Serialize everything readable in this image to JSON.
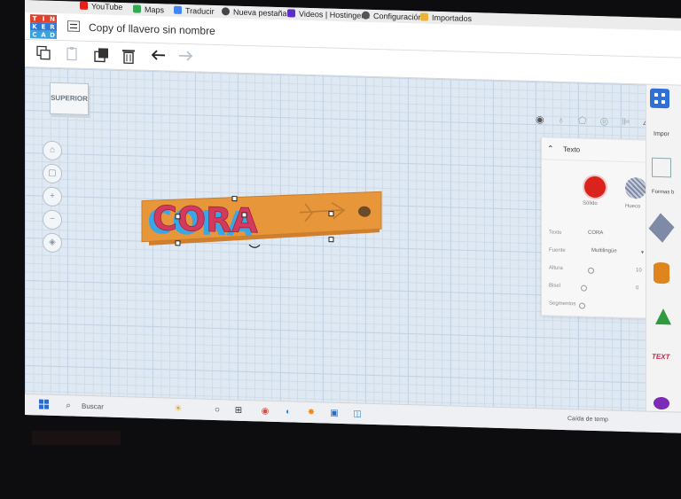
{
  "bookmarks": [
    {
      "label": "YouTube",
      "color": "#e62117"
    },
    {
      "label": "Maps",
      "color": "#34a853"
    },
    {
      "label": "Traducir",
      "color": "#4285f4"
    },
    {
      "label": "Nueva pestaña",
      "color": "#444444"
    },
    {
      "label": "Videos | Hostinger...",
      "color": "#5b2ec7"
    },
    {
      "label": "Configuración",
      "color": "#555555"
    },
    {
      "label": "Importados",
      "color": "#e8b53a"
    }
  ],
  "logo": {
    "letters": [
      "T",
      "I",
      "N",
      "K",
      "E",
      "R",
      "C",
      "A",
      "D"
    ],
    "colors": [
      "#e2412e",
      "#e2412e",
      "#e2412e",
      "#2f7ad6",
      "#2f7ad6",
      "#2f7ad6",
      "#37a2dd",
      "#37a2dd",
      "#37a2dd"
    ]
  },
  "header": {
    "title": "Copy of llavero sin nombre"
  },
  "workplane": {
    "viewcube_label": "SUPERIOR"
  },
  "keychain": {
    "text": "CORA",
    "body_color": "#e8963a",
    "text_color": "#d23a5e"
  },
  "inspector": {
    "title": "Texto",
    "solid_label": "Sólido",
    "hole_label": "Hueco",
    "solid_color": "#d9231c",
    "fields": [
      {
        "label": "Texto",
        "value": "CORA"
      },
      {
        "label": "Fuente",
        "value": "Multilingüe"
      },
      {
        "label": "Altura",
        "value": "10"
      },
      {
        "label": "Bisel",
        "value": "0"
      },
      {
        "label": "Segmentos",
        "value": "0"
      }
    ]
  },
  "rightpanel": {
    "label": "Impor",
    "shapes_label": "Formas b"
  },
  "taskbar": {
    "search_placeholder": "Buscar",
    "weather": "Caída de temp"
  }
}
